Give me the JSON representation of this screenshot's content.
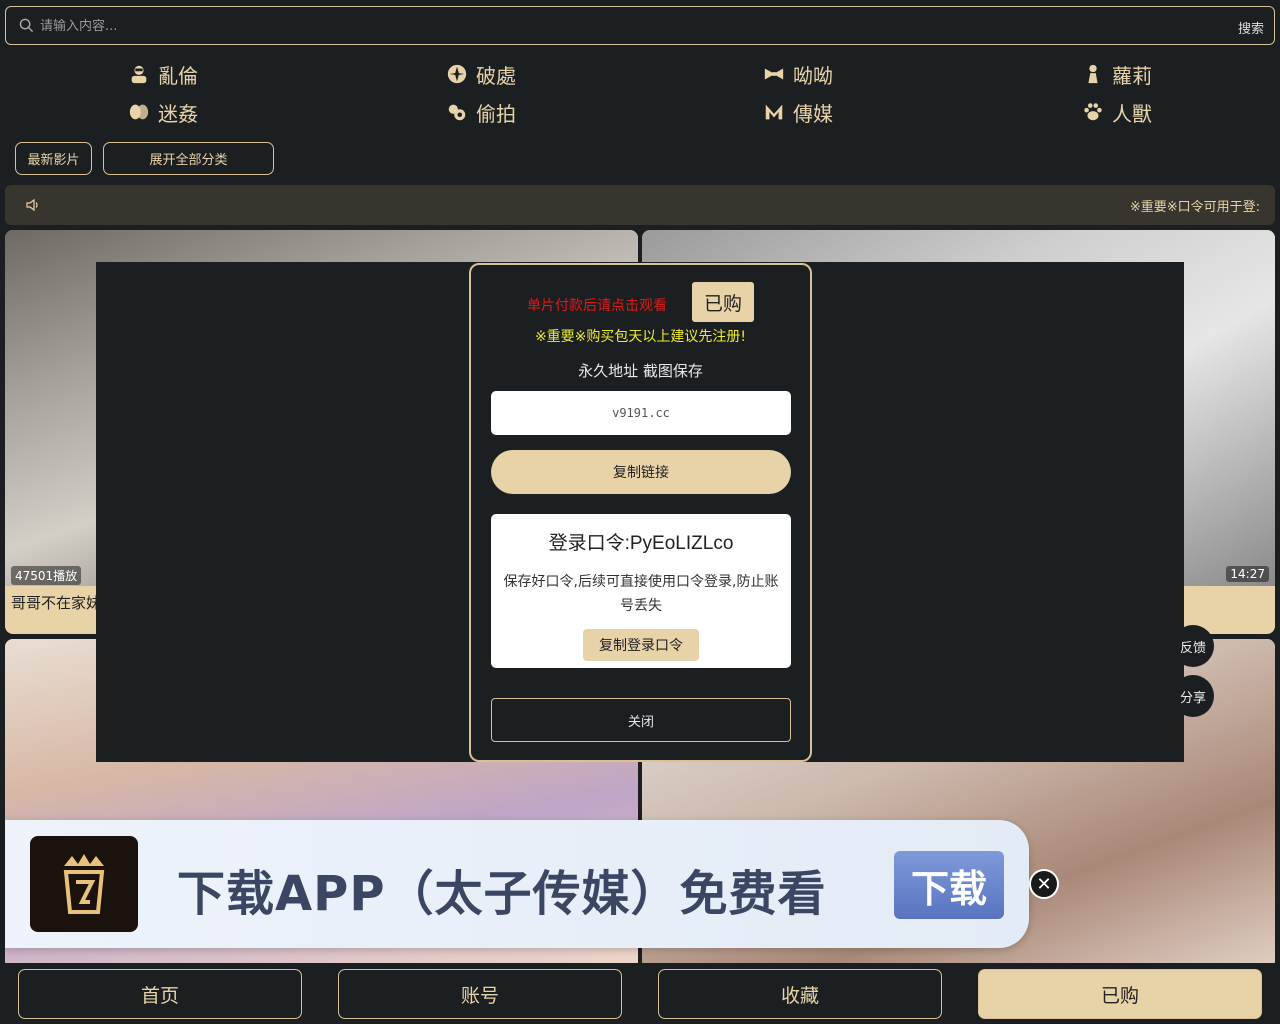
{
  "search": {
    "placeholder": "请输入内容...",
    "button": "搜索"
  },
  "categories": [
    {
      "label": "亂倫",
      "icon": "incognito-icon"
    },
    {
      "label": "破處",
      "icon": "cherry-blossom-icon"
    },
    {
      "label": "呦呦",
      "icon": "bowtie-icon"
    },
    {
      "label": "蘿莉",
      "icon": "girl-icon"
    },
    {
      "label": "迷姦",
      "icon": "pills-icon"
    },
    {
      "label": "偷拍",
      "icon": "camera-icon"
    },
    {
      "label": "傳媒",
      "icon": "m-logo-icon"
    },
    {
      "label": "人獸",
      "icon": "paw-icon"
    }
  ],
  "filters": {
    "latest": "最新影片",
    "expand": "展开全部分类"
  },
  "notice": {
    "text": "※重要※口令可用于登:"
  },
  "videos": [
    {
      "plays": "47501播放",
      "title": "哥哥不在家妹",
      "duration": ""
    },
    {
      "plays": "",
      "title": "",
      "duration": "14:27"
    },
    {
      "plays": "",
      "title": "",
      "duration": ""
    },
    {
      "plays": "",
      "title": "",
      "duration": ""
    }
  ],
  "modal": {
    "pay_text": "单片付款后请点击观看",
    "bought_label": "已购",
    "important": "※重要※购买包天以上建议先注册!",
    "permanent": "永久地址 截图保存",
    "url": "v9191.cc",
    "copy_link": "复制链接",
    "login_code": "登录口令:PyEoLIZLco",
    "login_desc": "保存好口令,后续可直接使用口令登录,防止账号丢失",
    "copy_code": "复制登录口令",
    "close": "关闭"
  },
  "floating": {
    "feedback": "反馈",
    "share": "分享"
  },
  "banner": {
    "slogan": "下载APP（太子传媒）免费看",
    "download": "下载",
    "close_icon": "close-circle-icon"
  },
  "tabs": [
    {
      "label": "首页",
      "active": false
    },
    {
      "label": "账号",
      "active": false
    },
    {
      "label": "收藏",
      "active": false
    },
    {
      "label": "已购",
      "active": true
    }
  ],
  "colors": {
    "accent": "#e8d3a8",
    "background": "#1c1f22",
    "warning": "#e01818",
    "highlight": "#ecec2a"
  }
}
